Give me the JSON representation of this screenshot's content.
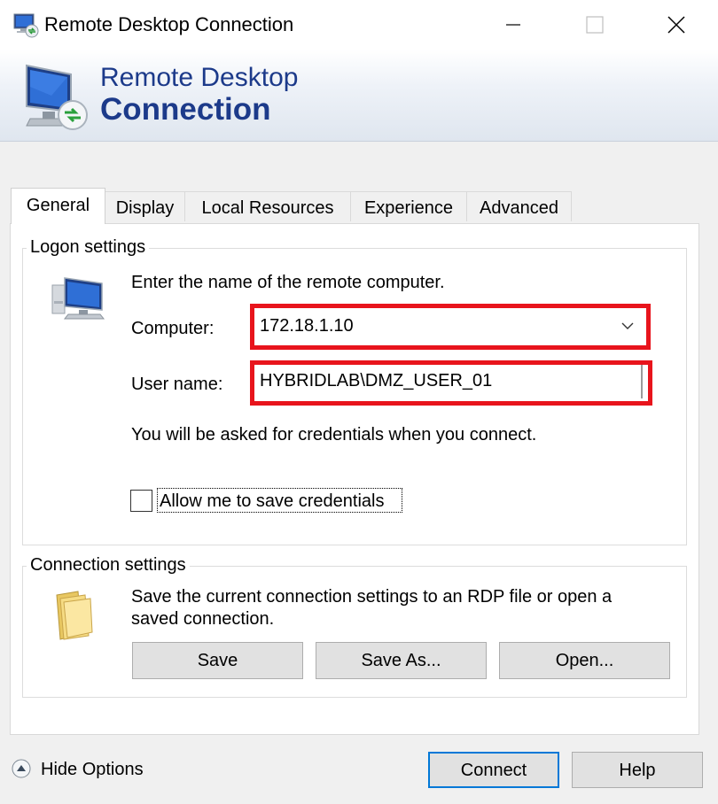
{
  "window": {
    "title": "Remote Desktop Connection"
  },
  "banner": {
    "line1": "Remote Desktop",
    "line2": "Connection"
  },
  "tabs": [
    {
      "label": "General",
      "active": true
    },
    {
      "label": "Display",
      "active": false
    },
    {
      "label": "Local Resources",
      "active": false
    },
    {
      "label": "Experience",
      "active": false
    },
    {
      "label": "Advanced",
      "active": false
    }
  ],
  "logon": {
    "group_title": "Logon settings",
    "prompt": "Enter the name of the remote computer.",
    "computer_label": "Computer:",
    "computer_value": "172.18.1.10",
    "username_label": "User name:",
    "username_value": "HYBRIDLAB\\DMZ_USER_01",
    "credentials_note": "You will be asked for credentials when you connect.",
    "save_credentials_label": "Allow me to save credentials",
    "save_credentials_checked": false
  },
  "connection": {
    "group_title": "Connection settings",
    "description_line1": "Save the current connection settings to an RDP file or open a",
    "description_line2": "saved connection.",
    "save_label": "Save",
    "save_as_label": "Save As...",
    "open_label": "Open..."
  },
  "footer": {
    "hide_options_label": "Hide Options",
    "connect_label": "Connect",
    "help_label": "Help"
  },
  "colors": {
    "accent": "#1c3a8a",
    "highlight": "#e8141c",
    "default_button_border": "#0078d7"
  }
}
